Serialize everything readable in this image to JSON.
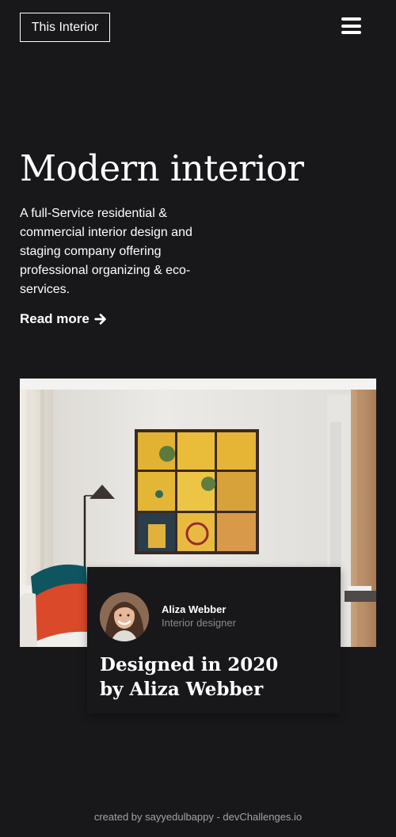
{
  "header": {
    "logo_text": "This Interior",
    "menu_icon": "hamburger-menu-icon"
  },
  "hero": {
    "title": "Modern interior",
    "description": "A full-Service residential & commercial interior design and staging company offering professional organizing & eco-services.",
    "read_more_label": "Read more",
    "read_more_icon": "arrow-right-icon"
  },
  "feature": {
    "image": "living-room-photo",
    "author_name": "Aliza Webber",
    "author_role": "Interior designer",
    "title_line1": "Designed in 2020",
    "title_line2": "by Aliza Webber"
  },
  "footer": {
    "credit": "created by sayyedulbappy - devChallenges.io"
  },
  "colors": {
    "background": "#18181b",
    "text": "#ffffff",
    "muted": "#8a8a8a"
  }
}
